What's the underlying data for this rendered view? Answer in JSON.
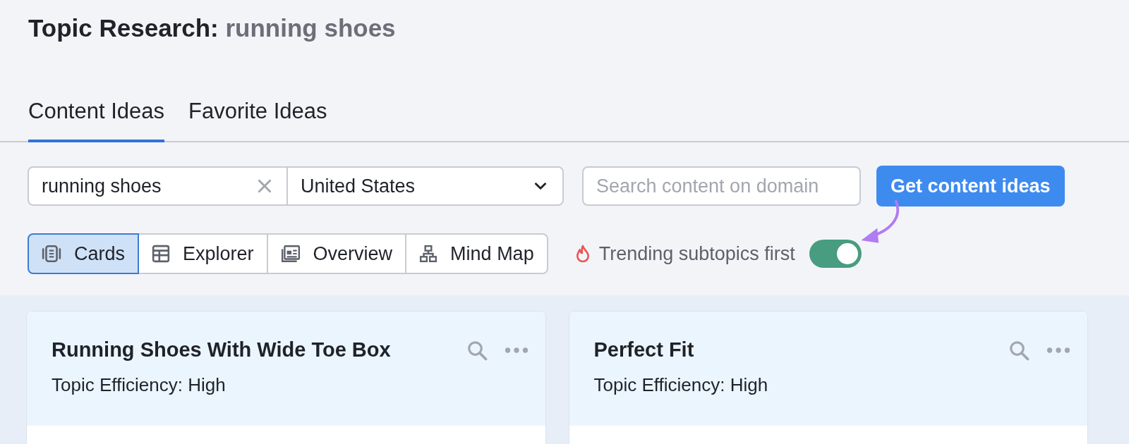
{
  "title": {
    "label": "Topic Research:",
    "query": "running shoes"
  },
  "tabs": [
    {
      "label": "Content Ideas",
      "selected": true
    },
    {
      "label": "Favorite Ideas",
      "selected": false
    }
  ],
  "search": {
    "value": "running shoes",
    "country": "United States",
    "domain_placeholder": "Search content on domain",
    "button": "Get content ideas"
  },
  "views": [
    {
      "label": "Cards",
      "kind": "cards",
      "selected": true
    },
    {
      "label": "Explorer",
      "kind": "explorer",
      "selected": false
    },
    {
      "label": "Overview",
      "kind": "overview",
      "selected": false
    },
    {
      "label": "Mind Map",
      "kind": "mindmap",
      "selected": false
    }
  ],
  "trending": {
    "label": "Trending subtopics first",
    "on": true
  },
  "cards": [
    {
      "title": "Running Shoes With Wide Toe Box",
      "efficiency": "Topic Efficiency: High"
    },
    {
      "title": "Perfect Fit",
      "efficiency": "Topic Efficiency: High"
    }
  ]
}
